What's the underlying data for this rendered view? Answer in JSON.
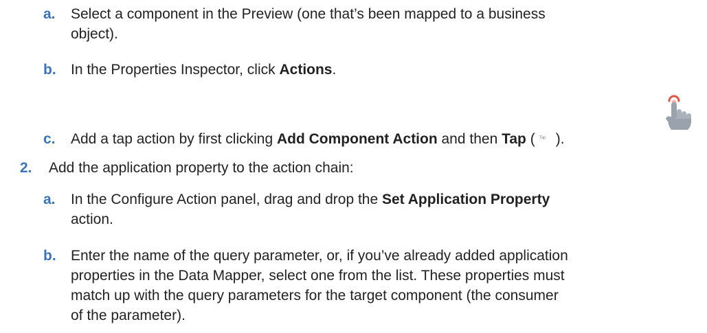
{
  "steps": {
    "s1a": {
      "marker": "a.",
      "line1": "Select a component in the Preview (one that’s been mapped to a business",
      "line2": "object)."
    },
    "s1b": {
      "marker": "b.",
      "pre": "In the Properties Inspector, click ",
      "bold": "Actions",
      "post": "."
    },
    "s1c": {
      "marker": "c.",
      "pre": "Add a tap action by first clicking ",
      "bold1": "Add Component Action",
      "mid": " and then ",
      "bold2": "Tap",
      "open": " (",
      "icon_text": "Tap",
      "close": ")."
    },
    "s2": {
      "marker": "2.",
      "text": "Add the application property to the action chain:"
    },
    "s2a": {
      "marker": "a.",
      "pre": "In the Configure Action panel, drag and drop the ",
      "bold": "Set Application Property",
      "line2": "action."
    },
    "s2b": {
      "marker": "b.",
      "line1": "Enter the name of the query parameter, or, if you’ve already added application",
      "line2": "properties in the Data Mapper, select one from the list. These properties must",
      "line3": "match up with the query parameters for the target component (the consumer",
      "line4": "of the parameter)."
    }
  },
  "icons": {
    "tap": "tap-gesture-icon"
  },
  "colors": {
    "marker": "#3b73b9",
    "text": "#222222",
    "icon_ring": "#e0574a",
    "icon_hand": "#9aa3ad"
  }
}
